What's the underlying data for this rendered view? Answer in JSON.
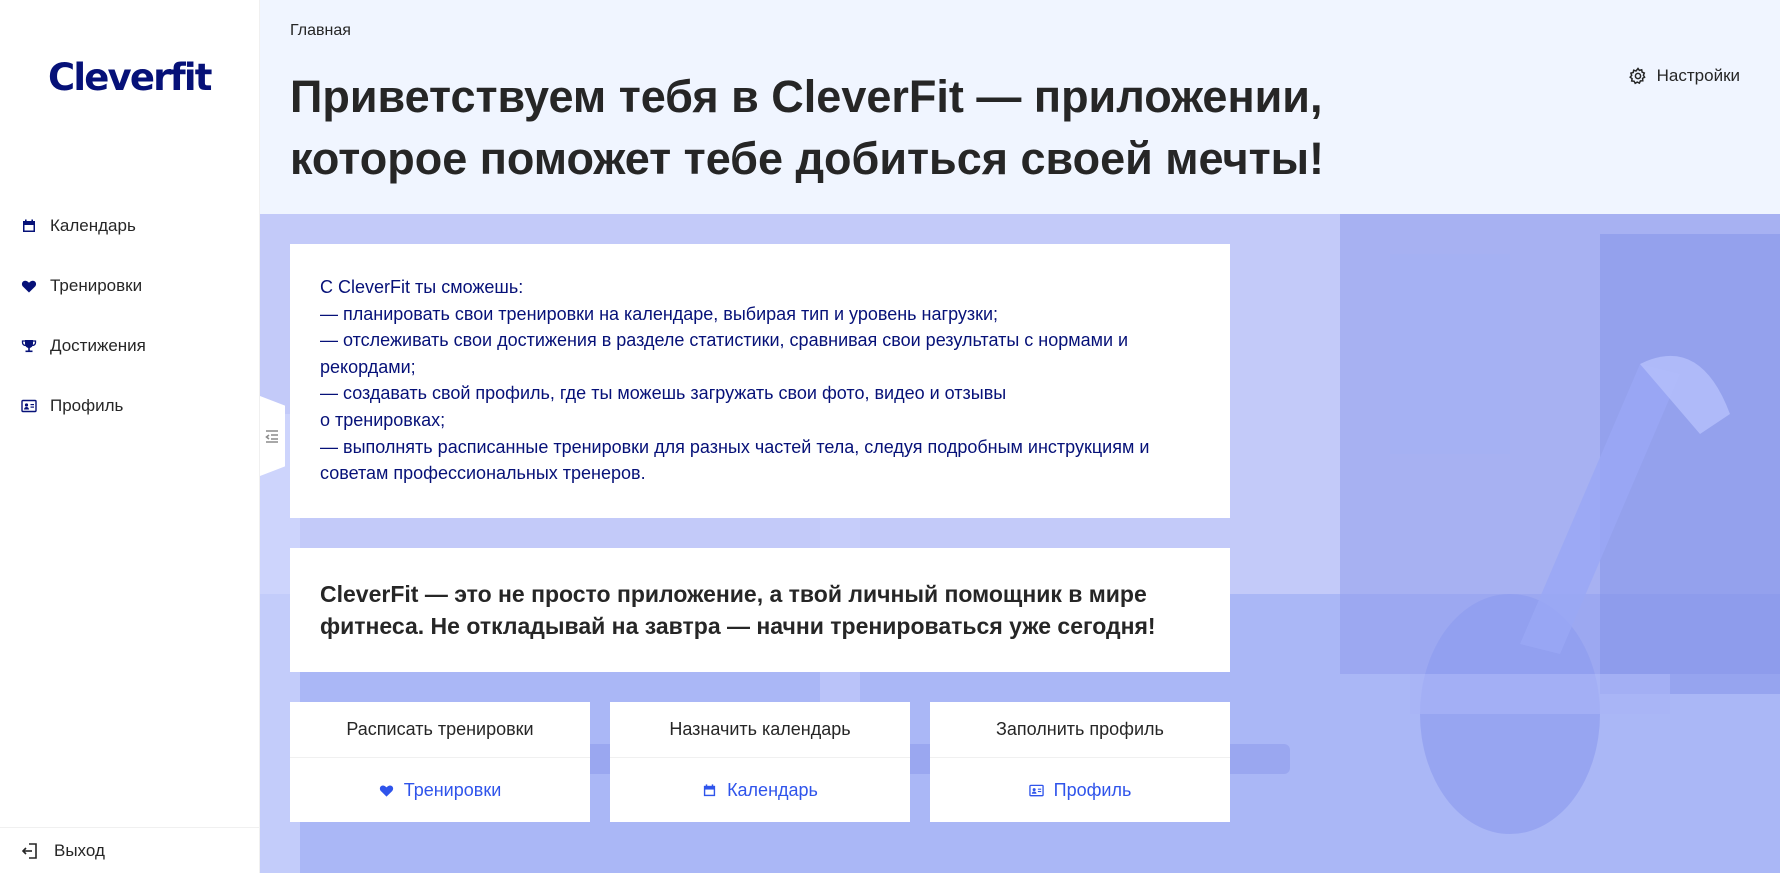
{
  "app": {
    "logo": "Cleverfit"
  },
  "sidebar": {
    "items": [
      {
        "label": "Календарь",
        "icon": "calendar-icon"
      },
      {
        "label": "Тренировки",
        "icon": "heart-icon"
      },
      {
        "label": "Достижения",
        "icon": "trophy-icon"
      },
      {
        "label": "Профиль",
        "icon": "idcard-icon"
      }
    ],
    "exit_label": "Выход"
  },
  "header": {
    "breadcrumb": "Главная",
    "title": "Приветствуем тебя в CleverFit — приложении, которое поможет тебе добиться своей мечты!",
    "settings_label": "Настройки"
  },
  "main": {
    "intro_text": "С CleverFit ты сможешь:\n— планировать свои тренировки на календаре, выбирая тип и уровень нагрузки;\n— отслеживать свои достижения в разделе статистики, сравнивая свои результаты с нормами и рекордами;\n— создавать свой профиль, где ты можешь загружать свои фото, видео и отзывы\nо тренировках;\n— выполнять расписанные тренировки для разных частей тела, следуя подробным инструкциям и советам профессиональных тренеров.",
    "cta_text": "CleverFit — это не просто приложение, а твой личный помощник в мире фитнеса. Не откладывай на завтра — начни тренироваться уже сегодня!",
    "actions": [
      {
        "title": "Расписать тренировки",
        "link": "Тренировки",
        "icon": "heart-icon"
      },
      {
        "title": "Назначить календарь",
        "link": "Календарь",
        "icon": "calendar-icon"
      },
      {
        "title": "Заполнить профиль",
        "link": "Профиль",
        "icon": "idcard-icon"
      }
    ]
  },
  "colors": {
    "brand": "#061178",
    "link": "#2f54eb",
    "header_bg": "#f0f5ff"
  }
}
